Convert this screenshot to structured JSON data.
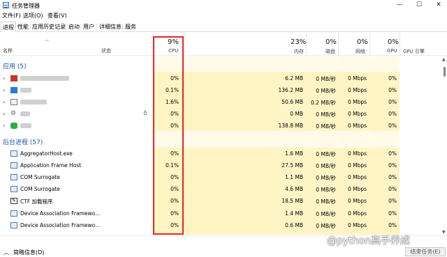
{
  "window": {
    "title": "任务管理器",
    "minimize": "—",
    "maximize": "☐",
    "close": "✕"
  },
  "menu": [
    "文件(F)",
    "选项(O)",
    "查看(V)"
  ],
  "tabs": [
    "进程",
    "性能",
    "应用历史记录",
    "启动",
    "用户",
    "详细信息",
    "服务"
  ],
  "columns": {
    "name": "名称",
    "status": "状态",
    "cpu_pct": "9%",
    "cpu": "CPU",
    "mem_pct": "23%",
    "mem": "内存",
    "disk_pct": "0%",
    "disk": "磁盘",
    "net_pct": "0%",
    "net": "网络",
    "gpu_pct": "0%",
    "gpu": "GPU",
    "gpu_engine": "GPU 引擎"
  },
  "groups": {
    "apps": "应用 (5)",
    "background": "后台进程 (57)"
  },
  "apps": [
    {
      "icon": "red-app-icon",
      "cpu": "0%",
      "mem": "6.2 MB",
      "disk": "0 MB/秒",
      "net": "0 Mbps",
      "gpu": "0%"
    },
    {
      "icon": "blue-app-icon",
      "cpu": "0.1%",
      "mem": "136.2 MB",
      "disk": "0 MB/秒",
      "net": "0 Mbps",
      "gpu": "0%"
    },
    {
      "icon": "image-app-icon",
      "cpu": "1.6%",
      "mem": "50.6 MB",
      "disk": "0.2 MB/秒",
      "net": "0 Mbps",
      "gpu": "0%"
    },
    {
      "icon": "settings-app-icon",
      "cpu": "0%",
      "mem": "0 MB",
      "disk": "0 MB/秒",
      "net": "0 Mbps",
      "gpu": "0%"
    },
    {
      "icon": "wechat-app-icon",
      "cpu": "0%",
      "mem": "138.8 MB",
      "disk": "0 MB/秒",
      "net": "0 Mbps",
      "gpu": "0%"
    }
  ],
  "background": [
    {
      "name": "AggregatorHost.exe",
      "cpu": "0%",
      "mem": "1.6 MB",
      "disk": "0 MB/秒",
      "net": "0 Mbps",
      "gpu": "0%"
    },
    {
      "name": "Application Frame Host",
      "cpu": "0.1%",
      "mem": "27.5 MB",
      "disk": "0 MB/秒",
      "net": "0 Mbps",
      "gpu": "0%"
    },
    {
      "name": "COM Surrogate",
      "cpu": "0%",
      "mem": "1.1 MB",
      "disk": "0 MB/秒",
      "net": "0 Mbps",
      "gpu": "0%"
    },
    {
      "name": "COM Surrogate",
      "cpu": "0%",
      "mem": "4.6 MB",
      "disk": "0 MB/秒",
      "net": "0 Mbps",
      "gpu": "0%"
    },
    {
      "name": "CTF 加载程序",
      "cpu": "0%",
      "mem": "18.5 MB",
      "disk": "0 MB/秒",
      "net": "0 Mbps",
      "gpu": "0%"
    },
    {
      "name": "Device Association Framewo...",
      "cpu": "0%",
      "mem": "1.4 MB",
      "disk": "0 MB/秒",
      "net": "0 Mbps",
      "gpu": "0%"
    },
    {
      "name": "Device Association Framewo...",
      "cpu": "0%",
      "mem": "0.6 MB",
      "disk": "0 MB/秒",
      "net": "0 Mbps",
      "gpu": "0%"
    }
  ],
  "status": {
    "toggle": "简略信息(D)",
    "end_task": "结束任务(E)"
  },
  "watermark": "@python高手养成"
}
